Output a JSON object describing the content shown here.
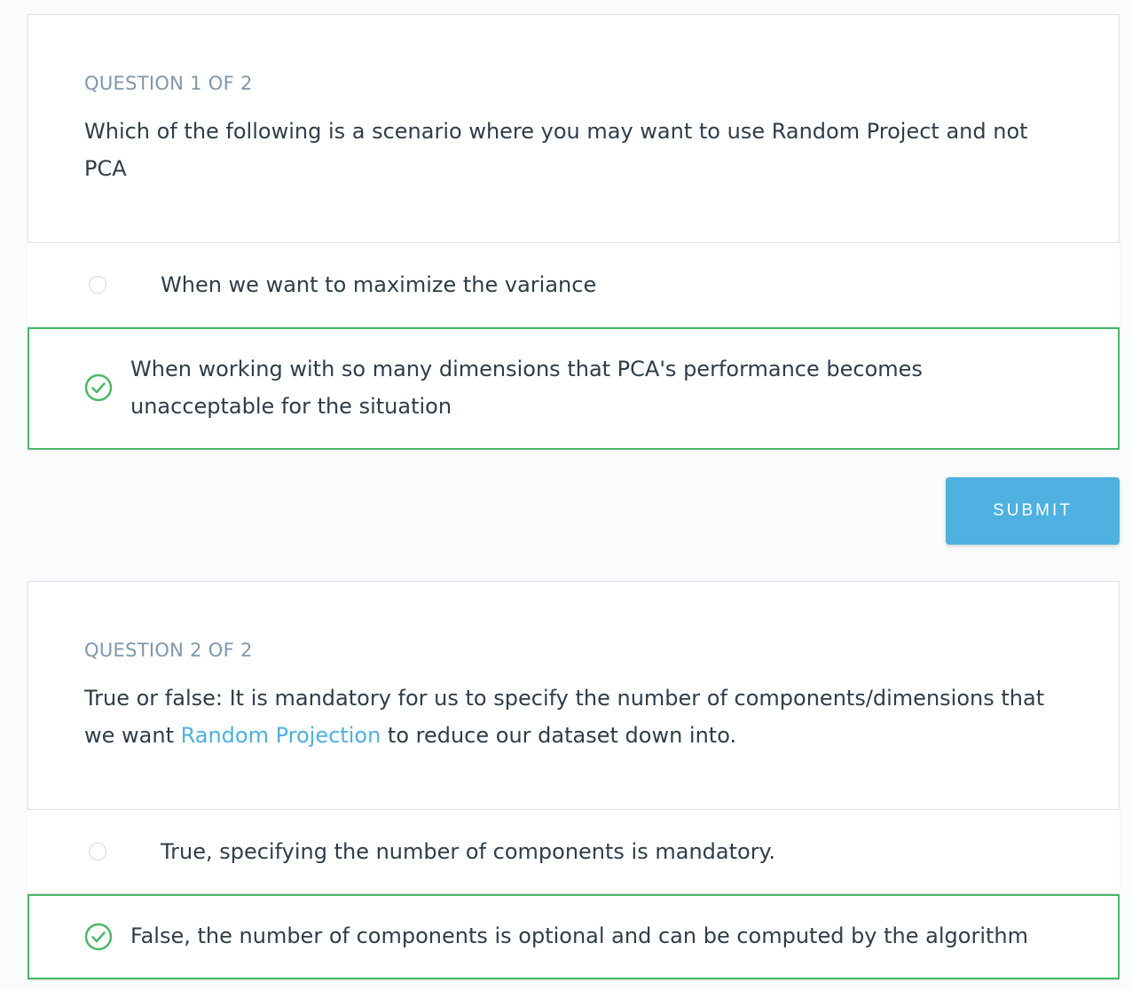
{
  "questions": [
    {
      "count": "QUESTION 1 OF 2",
      "text": "Which of the following is a scenario where you may want to use Random Project and not PCA",
      "options": [
        {
          "label": "When we want to maximize the variance",
          "state": "unselected"
        },
        {
          "label": "When working with so many dimensions that PCA's performance becomes unacceptable for the situation",
          "state": "correct"
        }
      ]
    },
    {
      "count": "QUESTION 2 OF 2",
      "text_before": "True or false: It is mandatory for us to specify the number of components/dimensions that we want ",
      "link_text": "Random Projection",
      "text_after": " to reduce our dataset down into.",
      "options": [
        {
          "label": "True, specifying the number of components is mandatory.",
          "state": "unselected"
        },
        {
          "label": "False, the number of components is optional and can be computed by the algorithm",
          "state": "correct"
        }
      ]
    }
  ],
  "submit": {
    "label": "SUBMIT"
  },
  "colors": {
    "accent": "#4eb1e1",
    "correct": "#4ab866",
    "muted": "#7d97ad",
    "text": "#2e3d49"
  },
  "icons": {
    "correct": "check-circle-icon",
    "unselected": "radio-empty-icon"
  }
}
